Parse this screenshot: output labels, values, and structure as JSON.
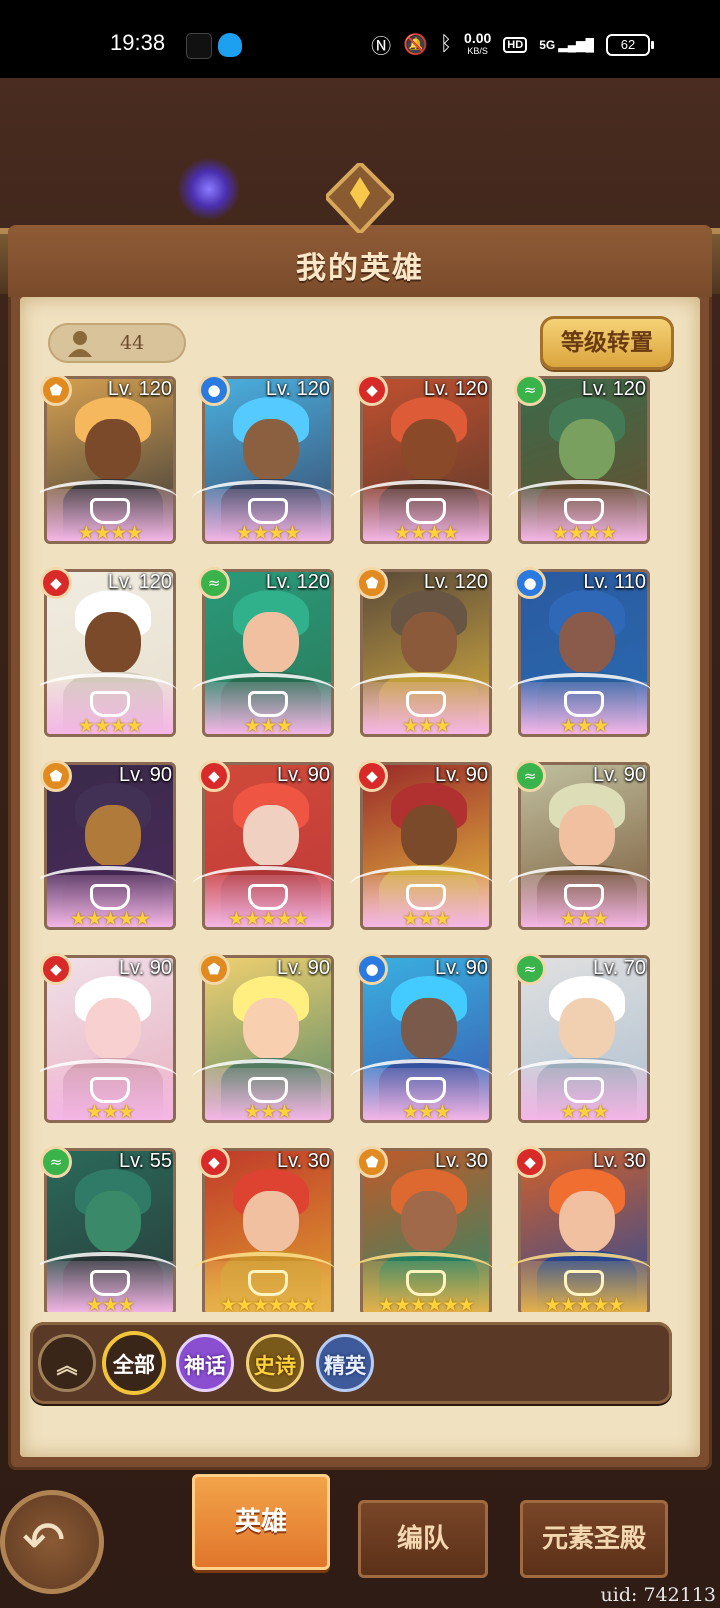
{
  "status_bar": {
    "time": "19:38",
    "net_speed": "0.00",
    "net_unit": "KB/S",
    "hd": "HD",
    "signal": "5G",
    "battery": "62"
  },
  "header": {
    "title": "我的英雄"
  },
  "hero_count": "44",
  "level_transfer_label": "等级转置",
  "heroes": [
    {
      "level": "Lv. 120",
      "element": "earth",
      "stars": "★★★★",
      "frame": "pink",
      "colors": [
        "#d6a050",
        "#7a4a2a",
        "#3a3a3a"
      ]
    },
    {
      "level": "Lv. 120",
      "element": "water",
      "stars": "★★★★",
      "frame": "pink",
      "colors": [
        "#4ab0e0",
        "#8a6040",
        "#3a4a6a"
      ]
    },
    {
      "level": "Lv. 120",
      "element": "fire",
      "stars": "★★★★",
      "frame": "pink",
      "colors": [
        "#c05030",
        "#8a4a2a",
        "#5a3a2a"
      ]
    },
    {
      "level": "Lv. 120",
      "element": "wind",
      "stars": "★★★★",
      "frame": "pink",
      "colors": [
        "#3a6a4a",
        "#7aa060",
        "#6a5030"
      ]
    },
    {
      "level": "Lv. 120",
      "element": "fire",
      "stars": "★★★★",
      "frame": "pink",
      "colors": [
        "#f0ece0",
        "#7a4a2a",
        "#e8e0d0"
      ]
    },
    {
      "level": "Lv. 120",
      "element": "wind",
      "stars": "★★★",
      "frame": "pink",
      "colors": [
        "#2a9a7a",
        "#f0c0a0",
        "#2a7a5a"
      ]
    },
    {
      "level": "Lv. 120",
      "element": "earth",
      "stars": "★★★",
      "frame": "pink",
      "colors": [
        "#5a4a3a",
        "#8a5a3a",
        "#d8b040"
      ]
    },
    {
      "level": "Lv. 110",
      "element": "water",
      "stars": "★★★",
      "frame": "pink",
      "colors": [
        "#2a5aa0",
        "#8a5a4a",
        "#2a6ab0"
      ]
    },
    {
      "level": "Lv. 90",
      "element": "earth",
      "stars": "★★★★★",
      "frame": "pink",
      "colors": [
        "#3a2a4a",
        "#b07a3a",
        "#4a2a5a"
      ]
    },
    {
      "level": "Lv. 90",
      "element": "fire",
      "stars": "★★★★★",
      "frame": "pink",
      "colors": [
        "#d04a3a",
        "#f0d0c0",
        "#c03a3a"
      ]
    },
    {
      "level": "Lv. 90",
      "element": "fire",
      "stars": "★★★",
      "frame": "pink",
      "colors": [
        "#9a2a2a",
        "#7a4a2a",
        "#e8c040"
      ]
    },
    {
      "level": "Lv. 90",
      "element": "wind",
      "stars": "★★★",
      "frame": "pink",
      "colors": [
        "#c0c0a0",
        "#f0c0a0",
        "#7a5a3a"
      ]
    },
    {
      "level": "Lv. 90",
      "element": "fire",
      "stars": "★★★",
      "frame": "pink",
      "colors": [
        "#f0e0e8",
        "#f8d0d0",
        "#e8b0c0"
      ]
    },
    {
      "level": "Lv. 90",
      "element": "earth",
      "stars": "★★★",
      "frame": "pink",
      "colors": [
        "#f0d070",
        "#f8d0b0",
        "#5a8a6a"
      ]
    },
    {
      "level": "Lv. 90",
      "element": "water",
      "stars": "★★★",
      "frame": "pink",
      "colors": [
        "#3ab0e0",
        "#7a5a4a",
        "#3a5ab0"
      ]
    },
    {
      "level": "Lv. 70",
      "element": "wind",
      "stars": "★★★",
      "frame": "pink",
      "colors": [
        "#e0e0e0",
        "#f0d0b0",
        "#b0c0d0"
      ]
    },
    {
      "level": "Lv. 55",
      "element": "wind",
      "stars": "★★★",
      "frame": "pink",
      "colors": [
        "#2a6a5a",
        "#3a8a6a",
        "#2a3a3a"
      ]
    },
    {
      "level": "Lv. 30",
      "element": "fire",
      "stars": "★★★★★★",
      "frame": "gold",
      "colors": [
        "#c03a2a",
        "#f0c0a0",
        "#e0a030"
      ]
    },
    {
      "level": "Lv. 30",
      "element": "earth",
      "stars": "★★★★★★",
      "frame": "gold",
      "colors": [
        "#c05a2a",
        "#a06a4a",
        "#2a8a6a"
      ]
    },
    {
      "level": "Lv. 30",
      "element": "fire",
      "stars": "★★★★★",
      "frame": "gold",
      "colors": [
        "#d0602a",
        "#f0c0a0",
        "#2a4a9a"
      ]
    }
  ],
  "filters": {
    "collapse_icon": "double-chevron-up-icon",
    "all": "全部",
    "mythic": "神话",
    "epic": "史诗",
    "elite": "精英"
  },
  "tabs": {
    "heroes": "英雄",
    "team": "编队",
    "shrine": "元素圣殿"
  },
  "uid": "uid: 742113",
  "colors": {
    "accent_gold": "#f1c43a",
    "active_tab": "#e0742a"
  }
}
